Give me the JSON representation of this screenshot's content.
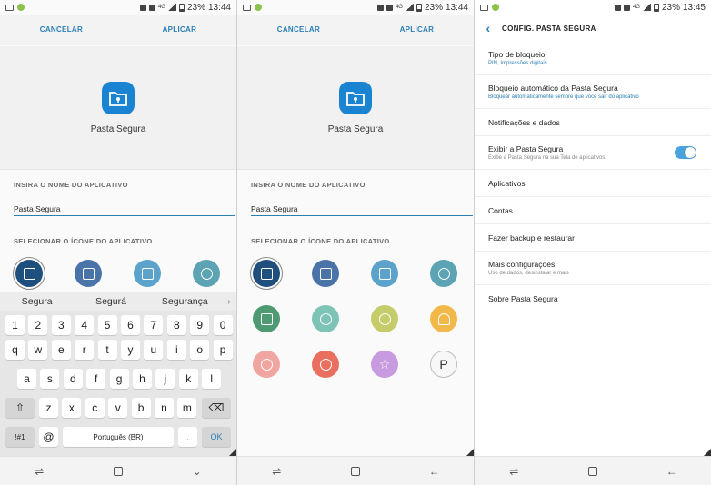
{
  "colors": {
    "accent": "#2a7fb5",
    "app_icon": "#1a84d3",
    "toggle_on": "#4aa3df"
  },
  "screens": [
    {
      "status": {
        "battery": "23%",
        "time": "13:44",
        "signal": "4G"
      }
    },
    {
      "status": {
        "battery": "23%",
        "time": "13:44",
        "signal": "4G"
      }
    },
    {
      "status": {
        "battery": "23%",
        "time": "13:45",
        "signal": "4G"
      }
    }
  ],
  "edit": {
    "cancel_label": "CANCELAR",
    "apply_label": "APLICAR",
    "app_name": "Pasta Segura",
    "name_section_label": "INSIRA O NOME DO APLICATIVO",
    "name_value": "Pasta Segura",
    "icon_section_label": "SELECIONAR O ÍCONE DO APLICATIVO"
  },
  "icons": [
    {
      "name": "check-folder-icon",
      "color": "#1f4f7c"
    },
    {
      "name": "briefcase-icon",
      "color": "#4a74a8"
    },
    {
      "name": "document-icon",
      "color": "#5ba3cb"
    },
    {
      "name": "chat-icon",
      "color": "#5ca4b4"
    },
    {
      "name": "image-icon",
      "color": "#4e9a73"
    },
    {
      "name": "gear-icon",
      "color": "#7ec4b6"
    },
    {
      "name": "bicycle-icon",
      "color": "#c4cd6a"
    },
    {
      "name": "headphones-icon",
      "color": "#f2b94a"
    },
    {
      "name": "heart-icon",
      "color": "#f1a5a0"
    },
    {
      "name": "piggy-bank-icon",
      "color": "#e9705e"
    },
    {
      "name": "star-icon",
      "color": "#c89be0"
    },
    {
      "name": "letter-p-icon",
      "color": "#f7f7f7",
      "glyph": "P"
    }
  ],
  "keyboard": {
    "suggestions": [
      "Segura",
      "Segurá",
      "Segurança"
    ],
    "row_numbers": [
      "1",
      "2",
      "3",
      "4",
      "5",
      "6",
      "7",
      "8",
      "9",
      "0"
    ],
    "row_1": [
      "q",
      "w",
      "e",
      "r",
      "t",
      "y",
      "u",
      "i",
      "o",
      "p"
    ],
    "row_2": [
      "a",
      "s",
      "d",
      "f",
      "g",
      "h",
      "j",
      "k",
      "l"
    ],
    "row_3": [
      "z",
      "x",
      "c",
      "v",
      "b",
      "n",
      "m"
    ],
    "sym_label": "!#1",
    "at_label": "@",
    "space_label": "Português (BR)",
    "period_label": ".",
    "ok_label": "OK"
  },
  "settings": {
    "title": "CONFIG. PASTA SEGURA",
    "items": [
      {
        "title": "Tipo de bloqueio",
        "subtitle": "PIN, Impressões digitais",
        "sub_color": "#2a7fb5"
      },
      {
        "title": "Bloqueio automático da Pasta Segura",
        "subtitle": "Bloquear automaticamente sempre que você sair do aplicativo",
        "sub_color": "#2a7fb5"
      },
      {
        "title": "Notificações e dados",
        "subtitle": ""
      },
      {
        "title": "Exibir a Pasta Segura",
        "subtitle": "Exibe a Pasta Segura na sua Tela de aplicativos.",
        "sub_color": "#888888",
        "toggle": true
      },
      {
        "title": "Aplicativos",
        "subtitle": ""
      },
      {
        "title": "Contas",
        "subtitle": ""
      },
      {
        "title": "Fazer backup e restaurar",
        "subtitle": ""
      },
      {
        "title": "Mais configurações",
        "subtitle": "Uso de dados, desinstalar e mais",
        "sub_color": "#888888"
      },
      {
        "title": "Sobre Pasta Segura",
        "subtitle": ""
      }
    ]
  }
}
